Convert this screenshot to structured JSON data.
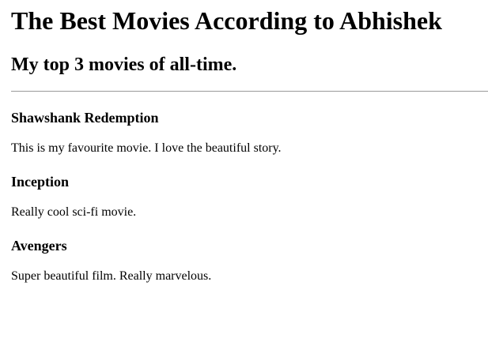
{
  "page": {
    "heading": "The Best Movies According to Abhishek",
    "subheading": "My top 3 movies of all-time."
  },
  "movies": [
    {
      "title": "Shawshank Redemption",
      "description": "This is my favourite movie. I love the beautiful story."
    },
    {
      "title": "Inception",
      "description": "Really cool sci-fi movie."
    },
    {
      "title": "Avengers",
      "description": "Super beautiful film. Really marvelous."
    }
  ]
}
